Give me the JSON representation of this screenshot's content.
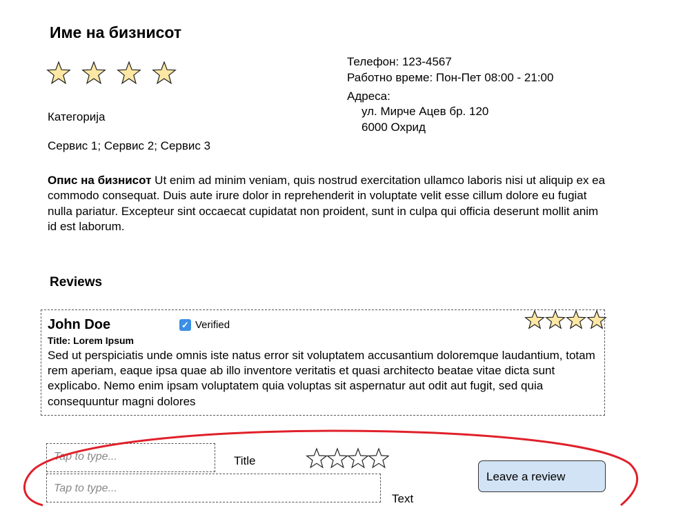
{
  "business": {
    "name": "Име на бизнисот",
    "rating": 4,
    "category": "Категорија",
    "services": "Сервис 1; Сервис 2; Сервис 3",
    "phone": "Телефон: 123-4567",
    "hours": "Работно време: Пон-Пет 08:00 - 21:00",
    "address_label": "Адреса:",
    "address_line1": "ул. Мирче Ацев бр. 120",
    "address_line2": "6000 Охрид",
    "description_label": "Опис на бизнисот",
    "description_text": " Ut enim ad minim veniam, quis nostrud exercitation ullamco laboris nisi ut aliquip ex ea commodo consequat. Duis aute irure dolor in reprehenderit in voluptate velit esse cillum dolore eu fugiat nulla pariatur. Excepteur sint occaecat cupidatat non proident, sunt in culpa qui officia deserunt mollit anim id est laborum."
  },
  "reviews": {
    "heading": "Reviews",
    "items": [
      {
        "author": "John Doe",
        "verified_label": "Verified",
        "title": "Title: Lorem Ipsum",
        "rating": 4,
        "text": "Sed ut perspiciatis unde omnis iste natus error sit voluptatem accusantium doloremque laudantium, totam rem aperiam, eaque ipsa quae ab illo inventore veritatis et quasi architecto beatae vitae dicta sunt explicabo. Nemo enim ipsam voluptatem quia voluptas sit aspernatur aut odit aut fugit, sed quia consequuntur magni dolores"
      }
    ]
  },
  "form": {
    "title_placeholder": "Tap to type...",
    "title_label": "Title",
    "text_placeholder": "Tap to type...",
    "text_label": "Text",
    "rating_selected": 0,
    "rating_max": 4,
    "submit_label": "Leave a review"
  },
  "colors": {
    "star_fill": "#fde7a4",
    "button_bg": "#d2e3f5",
    "highlight": "#e0202a",
    "verified": "#3b8ee6"
  },
  "icons": [
    "star-icon",
    "verified-check-icon",
    "star-outline-icon"
  ]
}
